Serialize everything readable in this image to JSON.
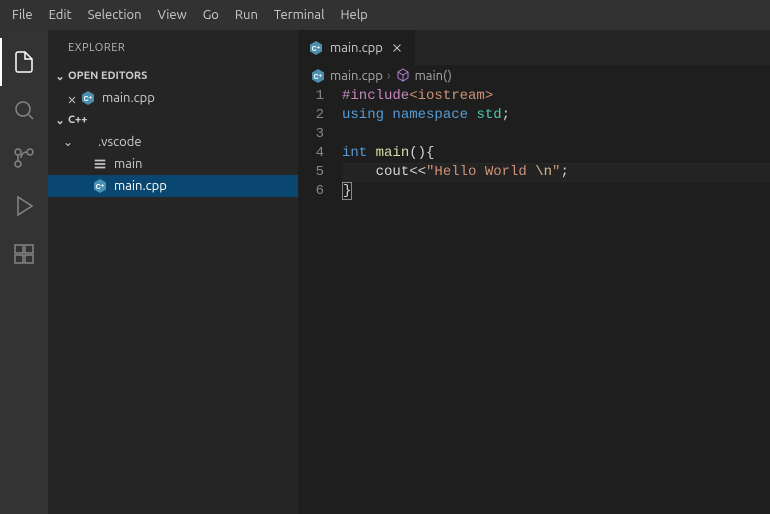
{
  "menu": [
    "File",
    "Edit",
    "Selection",
    "View",
    "Go",
    "Run",
    "Terminal",
    "Help"
  ],
  "sidebar": {
    "title": "EXPLORER",
    "openEditorsHeader": "OPEN EDITORS",
    "openEditors": [
      {
        "name": "main.cpp",
        "dirty": true
      }
    ],
    "workspaceHeader": "C++",
    "tree": [
      {
        "name": ".vscode",
        "type": "folder",
        "expanded": true,
        "level": 1
      },
      {
        "name": "main",
        "type": "binary",
        "level": 2
      },
      {
        "name": "main.cpp",
        "type": "cpp",
        "level": 2,
        "selected": true
      }
    ]
  },
  "tab": {
    "name": "main.cpp"
  },
  "breadcrumbs": {
    "file": "main.cpp",
    "symbol": "main()"
  },
  "editor": {
    "lineNumbers": [
      "1",
      "2",
      "3",
      "4",
      "5",
      "6"
    ],
    "activeLine": 5,
    "lines": [
      {
        "tokens": [
          {
            "t": "#include",
            "c": "tk-pre"
          },
          {
            "t": "<iostream>",
            "c": "tk-inc"
          }
        ]
      },
      {
        "tokens": [
          {
            "t": "using",
            "c": "tk-kw"
          },
          {
            "t": " ",
            "c": "tk-punc"
          },
          {
            "t": "namespace",
            "c": "tk-kw"
          },
          {
            "t": " ",
            "c": "tk-punc"
          },
          {
            "t": "std",
            "c": "tk-ns"
          },
          {
            "t": ";",
            "c": "tk-punc"
          }
        ]
      },
      {
        "tokens": []
      },
      {
        "tokens": [
          {
            "t": "int",
            "c": "tk-type"
          },
          {
            "t": " ",
            "c": "tk-punc"
          },
          {
            "t": "main",
            "c": "tk-fn"
          },
          {
            "t": "()",
            "c": "tk-punc"
          },
          {
            "t": "{",
            "c": "tk-punc"
          }
        ]
      },
      {
        "tokens": [
          {
            "t": "    cout<<",
            "c": "tk-punc"
          },
          {
            "t": "\"Hello World ",
            "c": "tk-str"
          },
          {
            "t": "\\n",
            "c": "tk-esc"
          },
          {
            "t": "\"",
            "c": "tk-str"
          },
          {
            "t": ";",
            "c": "tk-punc"
          }
        ]
      },
      {
        "tokens": [
          {
            "t": "}",
            "c": "tk-brace-box"
          }
        ]
      }
    ]
  }
}
